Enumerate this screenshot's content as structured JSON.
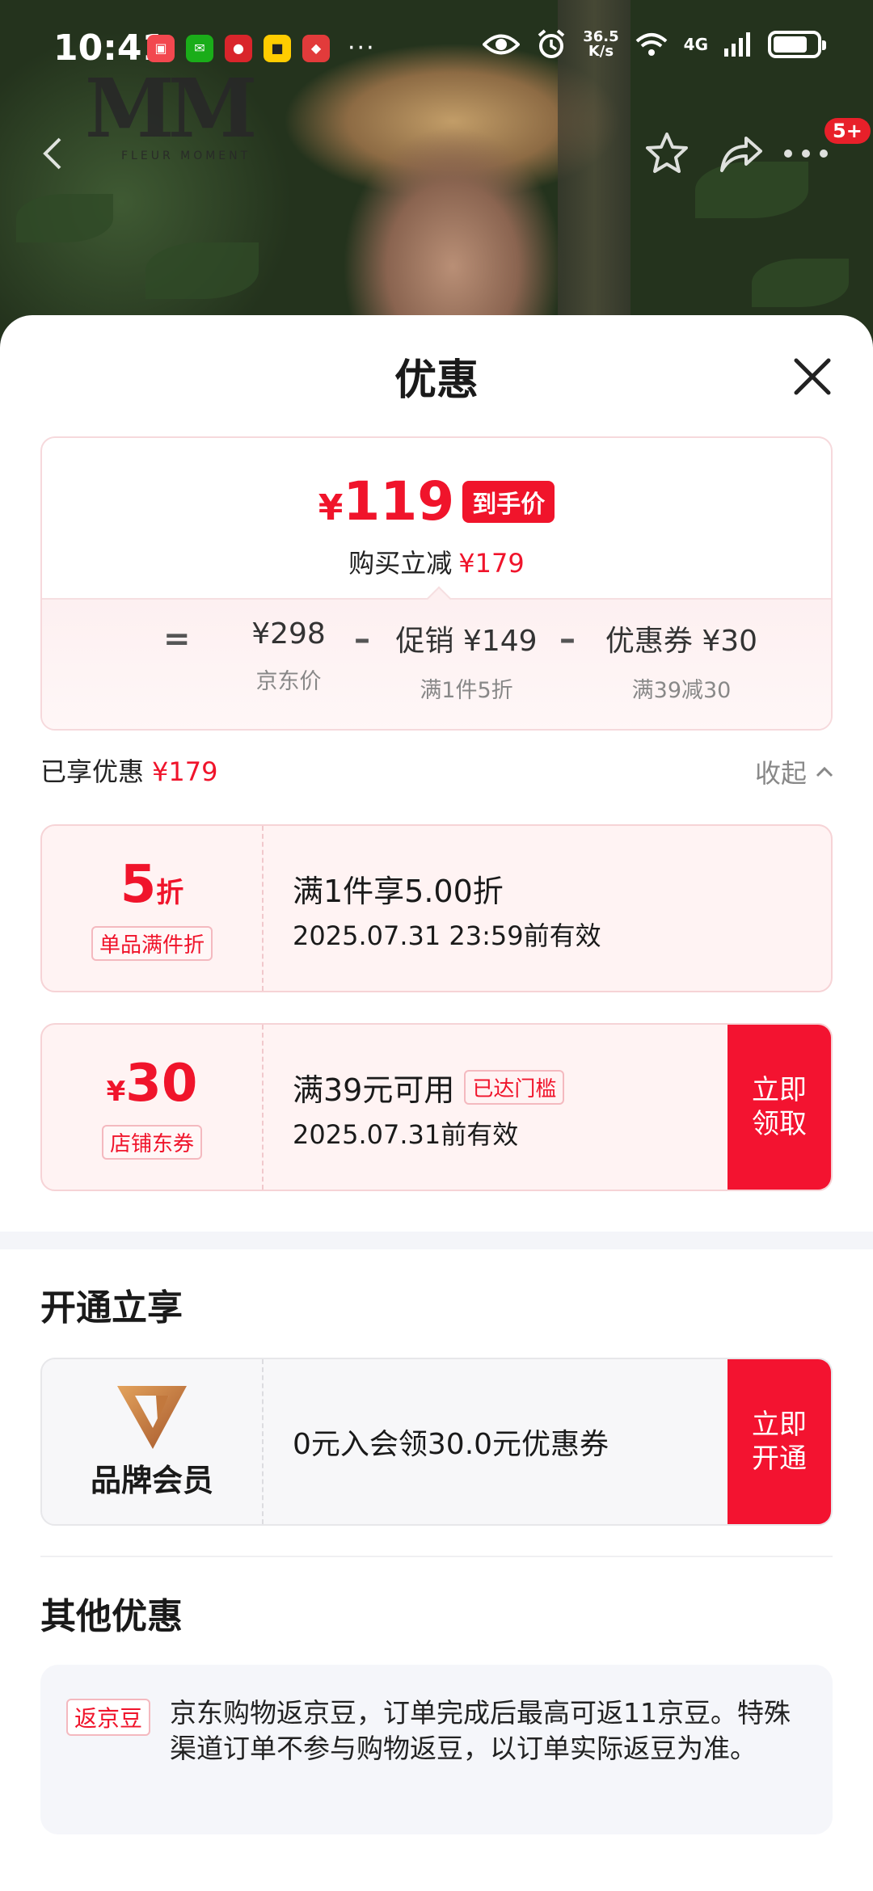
{
  "status_bar": {
    "time": "10:41",
    "more": "···",
    "speed_value": "36.5",
    "speed_unit": "K/s",
    "network": "4G"
  },
  "header": {
    "cart_badge": "5+"
  },
  "sheet": {
    "title": "优惠"
  },
  "summary": {
    "final_price_symbol": "¥",
    "final_price": "119",
    "final_tag": "到手价",
    "save_label": "购买立减",
    "save_amount": "¥179",
    "eq": "=",
    "minus": "–",
    "items": [
      {
        "value": "¥298",
        "label": "京东价"
      },
      {
        "value": "促销 ¥149",
        "label": "满1件5折"
      },
      {
        "value": "优惠券 ¥30",
        "label": "满39减30"
      }
    ]
  },
  "enjoyed": {
    "label": "已享优惠",
    "amount": "¥179",
    "collapse": "收起"
  },
  "coupons": [
    {
      "big": "5",
      "unit": "折",
      "type": "单品满件折",
      "line1": "满1件享5.00折",
      "line2": "2025.07.31 23:59前有效"
    },
    {
      "symbol": "¥",
      "big": "30",
      "type": "店铺东券",
      "line1": "满39元可用",
      "reached": "已达门槛",
      "line2": "2025.07.31前有效",
      "action": "立即领取"
    }
  ],
  "open_section": {
    "title": "开通立享",
    "brand_label": "品牌会员",
    "text": "0元入会领30.0元优惠券",
    "action": "立即开通"
  },
  "other_section": {
    "title": "其他优惠",
    "tag": "返京豆",
    "desc": "京东购物返京豆，订单完成后最高可返11京豆。特殊渠道订单不参与购物返豆，以订单实际返豆为准。"
  },
  "colors": {
    "accent": "#f0142b",
    "action_bg": "#f31330"
  }
}
